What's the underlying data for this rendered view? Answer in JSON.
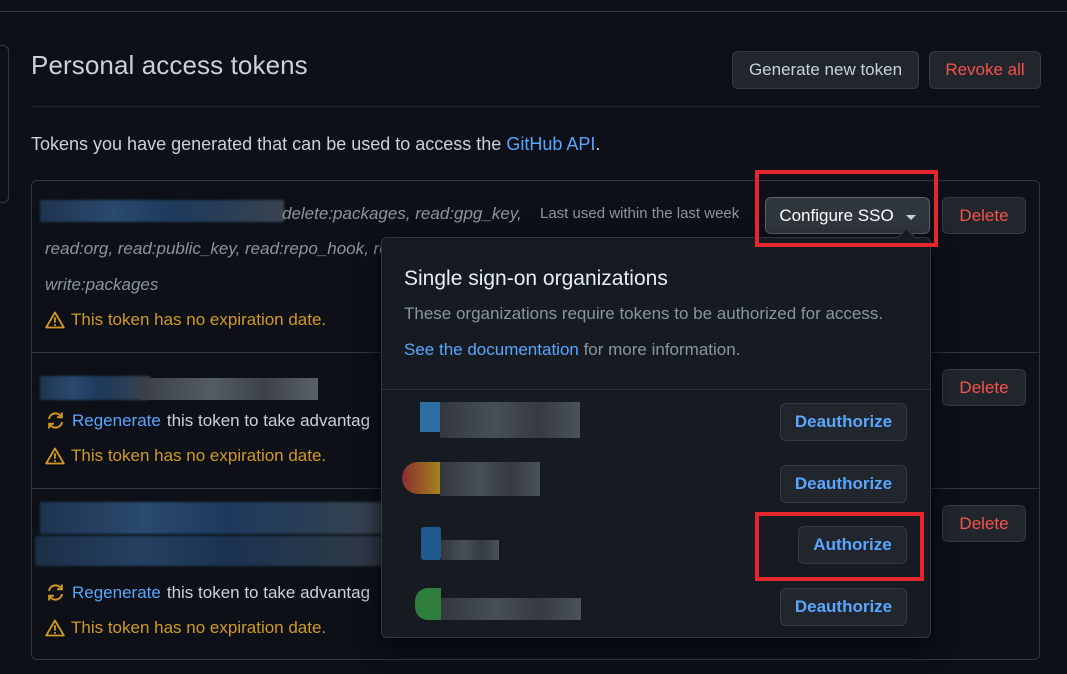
{
  "page": {
    "title": "Personal access tokens"
  },
  "header": {
    "generate_label": "Generate new token",
    "revoke_label": "Revoke all"
  },
  "intro": {
    "text": "Tokens you have generated that can be used to access the ",
    "link": "GitHub API",
    "suffix": "."
  },
  "tokens": [
    {
      "scopes_line1": "delete:packages, read:gpg_key,",
      "scopes_line2": "read:org, read:public_key, read:repo_hook, re",
      "scopes_line3": "write:packages",
      "last_used": "Last used within the last week",
      "sso_label": "Configure SSO",
      "delete_label": "Delete",
      "warning": "This token has no expiration date."
    },
    {
      "regen_link": "Regenerate",
      "regen_text": " this token to take advantag",
      "delete_label": "Delete",
      "warning": "This token has no expiration date."
    },
    {
      "regen_link": "Regenerate",
      "regen_text": " this token to take advantag",
      "delete_label": "Delete",
      "warning": "This token has no expiration date."
    }
  ],
  "sso_dropdown": {
    "title": "Single sign-on organizations",
    "description": "These organizations require tokens to be authorized for access.",
    "doc_link": "See the documentation",
    "doc_suffix": " for more information.",
    "orgs": [
      {
        "action": "Deauthorize"
      },
      {
        "action": "Deauthorize"
      },
      {
        "action": "Authorize"
      },
      {
        "action": "Deauthorize"
      }
    ]
  },
  "colors": {
    "accent": "#58a6ff",
    "danger": "#f85149",
    "warning": "#d29922",
    "highlight": "#e5262e"
  },
  "icons": {
    "warning": "alert-triangle-icon",
    "regenerate": "sync-icon",
    "dropdown": "caret-down-icon"
  }
}
